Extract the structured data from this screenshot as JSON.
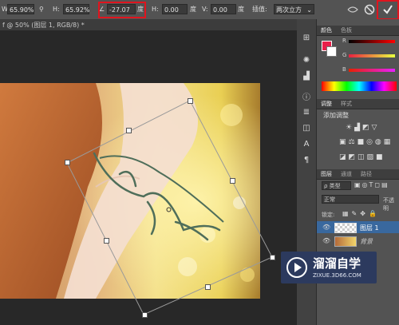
{
  "options_bar": {
    "w_value": "65.90%",
    "h_label": "H:",
    "h_value": "65.92%",
    "angle_value": "-27.07",
    "angle_unit": "度",
    "hskew_label": "H:",
    "hskew_value": "0.00",
    "hskew_unit": "度",
    "vskew_label": "V:",
    "vskew_value": "0.00",
    "vskew_unit": "度",
    "interp_label": "插值:",
    "interp_value": "两次立方",
    "commit_icon": "checkmark-icon",
    "cancel_icon": "cancel-icon",
    "warp_icon": "warp-icon"
  },
  "document_tab": {
    "title": "f @ 50% (图层 1, RGB/8) *"
  },
  "color_panel": {
    "tabs": [
      "颜色",
      "色板"
    ],
    "channels": [
      "R",
      "G",
      "B"
    ],
    "foreground": "#e8204a"
  },
  "adjustments_panel": {
    "tabs": [
      "调整",
      "样式"
    ],
    "heading": "添加调整"
  },
  "layers_panel": {
    "tabs": [
      "图层",
      "通道",
      "路径"
    ],
    "filter_label": "ρ 类型",
    "blend_mode": "正常",
    "opacity_label": "不透明",
    "lock_label": "锁定:",
    "layers": [
      {
        "name": "图层 1",
        "selected": true
      },
      {
        "name": "背景",
        "selected": false
      }
    ]
  },
  "watermark": {
    "title": "溜溜自学",
    "url": "ZIXUE.3D66.COM"
  },
  "colors": {
    "highlight": "#e0141e",
    "selection": "#39689e"
  }
}
